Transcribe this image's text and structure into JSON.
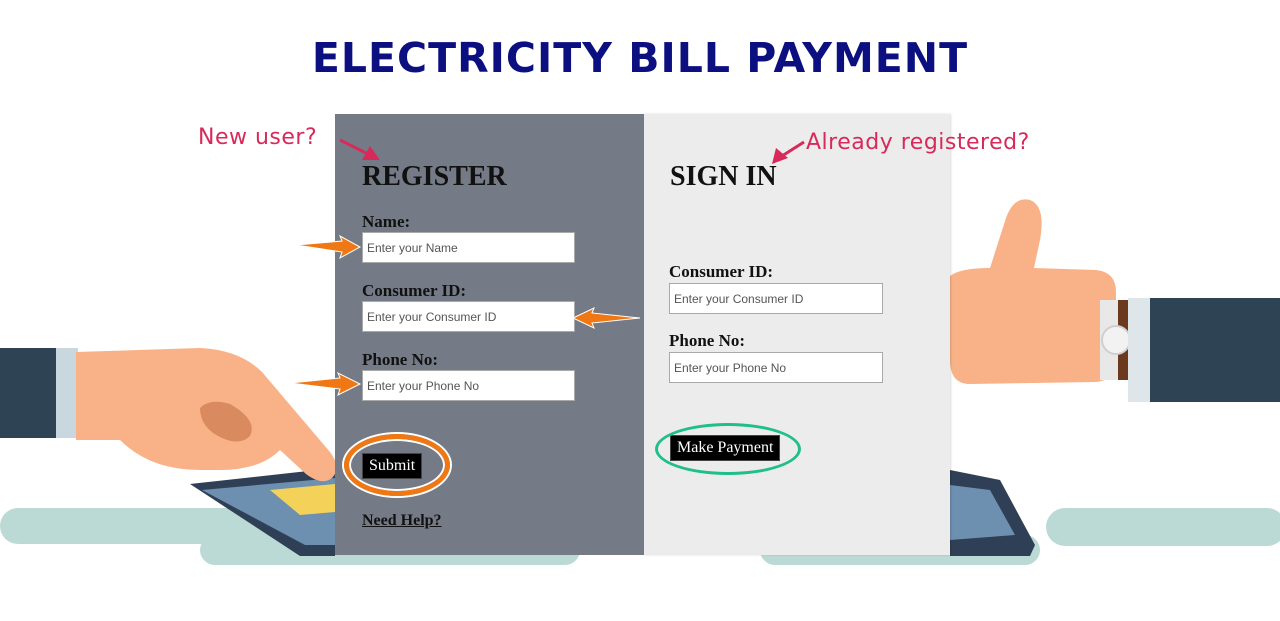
{
  "page": {
    "title": "ELECTRICITY BILL PAYMENT"
  },
  "annotations": {
    "new_user": "New user?",
    "already_registered": "Already registered?"
  },
  "register": {
    "heading": "REGISTER",
    "name_label": "Name:",
    "name_placeholder": "Enter your Name",
    "consumer_id_label": "Consumer ID:",
    "consumer_id_placeholder": "Enter your Consumer ID",
    "phone_label": "Phone No:",
    "phone_placeholder": "Enter your Phone No",
    "submit_label": "Submit",
    "help_label": "Need Help?"
  },
  "signin": {
    "heading": "SIGN IN",
    "consumer_id_label": "Consumer ID:",
    "consumer_id_placeholder": "Enter your Consumer ID",
    "phone_label": "Phone No:",
    "phone_placeholder": "Enter your Phone No",
    "pay_label": "Make Payment"
  },
  "colors": {
    "title": "#0c0f80",
    "register_panel": "#757b86",
    "signin_panel": "#ececec",
    "annotation_text": "#d72a5a",
    "arrow_orange": "#f07814",
    "submit_ring": "#f07814",
    "pay_ring": "#1fbf8a"
  },
  "icons": {
    "left_hand": "pointing-hand-illustration",
    "right_hand": "thumbs-up-hand-illustration",
    "tablet": "tablet-illustration"
  }
}
